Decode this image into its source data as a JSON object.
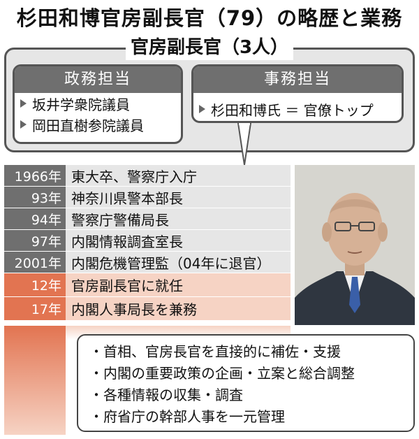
{
  "title": "杉田和博官房副長官（79）の略歴と業務",
  "group": {
    "label": "官房副長官（3人）",
    "political": {
      "header": "政務担当",
      "members": [
        "坂井学衆院議員",
        "岡田直樹参院議員"
      ]
    },
    "administrative": {
      "header": "事務担当",
      "members": [
        "杉田和博氏 ＝ 官僚トップ"
      ]
    }
  },
  "career": [
    {
      "year": "1966年",
      "event": "東大卒、警察庁入庁"
    },
    {
      "year": "93年",
      "event": "神奈川県警本部長"
    },
    {
      "year": "94年",
      "event": "警察庁警備局長"
    },
    {
      "year": "97年",
      "event": "内閣情報調査室長"
    },
    {
      "year": "2001年",
      "event": "内閣危機管理監（04年に退官）"
    },
    {
      "year": "12年",
      "event": "官房副長官に就任"
    },
    {
      "year": "17年",
      "event": "内閣人事局長を兼務"
    }
  ],
  "duties": [
    "・首相、官房長官を直接的に補佐・支援",
    "・内閣の重要政策の企画・立案と総合調整",
    "・各種情報の収集・調査",
    "・府省庁の幹部人事を一元管理"
  ],
  "colors": {
    "gray_header": "#6f6f6f",
    "orange": "#e27451",
    "light_orange": "#f6d3c4",
    "panel_gray": "#e6e6e6"
  }
}
